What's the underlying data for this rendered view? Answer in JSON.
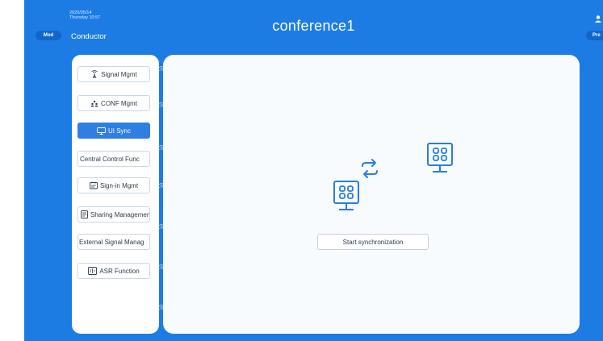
{
  "header": {
    "date": "2020/05/14",
    "weekday_time": "Thursday 10:57",
    "mode_button": "Mod",
    "conductor_label": "Conductor",
    "title": "conference1",
    "right_button": "Pre"
  },
  "sidebar": {
    "items": [
      {
        "label": "Signal Mgmt",
        "icon": "signal-icon",
        "active": false
      },
      {
        "label": "CONF Mgmt",
        "icon": "people-icon",
        "active": false
      },
      {
        "label": "UI Sync",
        "icon": "monitor-icon",
        "active": true
      },
      {
        "label": "Central Control Func",
        "icon": "control-icon",
        "active": false
      },
      {
        "label": "Sign-in Mgmt",
        "icon": "signin-icon",
        "active": false
      },
      {
        "label": "Sharing Management",
        "icon": "share-icon",
        "active": false
      },
      {
        "label": "External Signal Manag",
        "icon": "external-signal-icon",
        "active": false
      },
      {
        "label": "ASR Function",
        "icon": "asr-icon",
        "active": false
      }
    ]
  },
  "main": {
    "start_button": "Start synchronization"
  },
  "colors": {
    "background_blue": "#1d7ce3",
    "accent_blue": "#2f7fe3",
    "icon_blue": "#2a7de0"
  }
}
